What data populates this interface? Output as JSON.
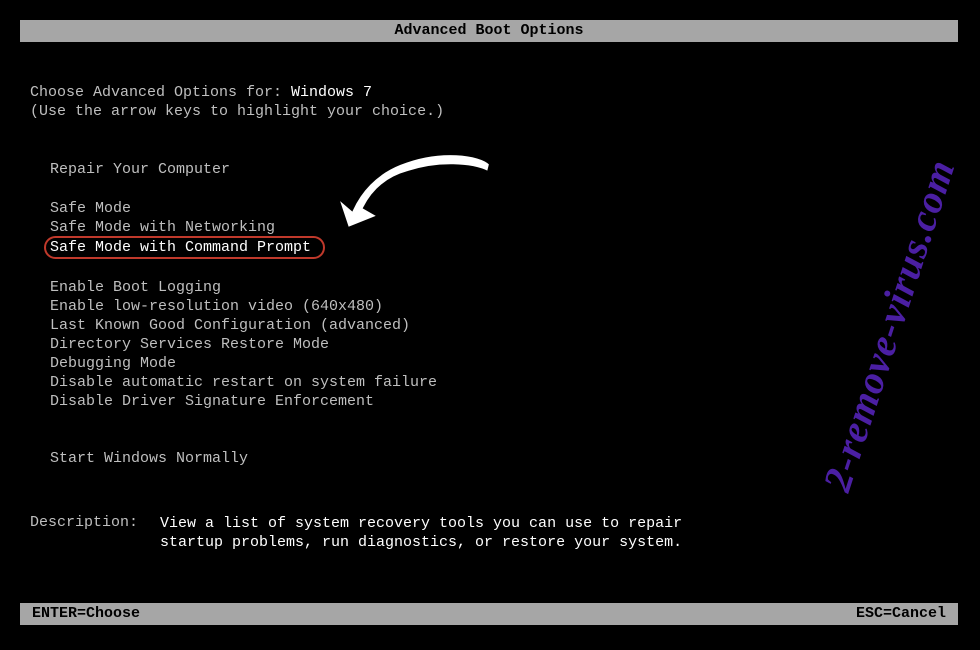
{
  "title": "Advanced Boot Options",
  "prompt_prefix": "Choose Advanced Options for: ",
  "os_name": "Windows 7",
  "hint": "(Use the arrow keys to highlight your choice.)",
  "menu": {
    "group1": [
      "Repair Your Computer"
    ],
    "group2": [
      "Safe Mode",
      "Safe Mode with Networking",
      "Safe Mode with Command Prompt"
    ],
    "group3": [
      "Enable Boot Logging",
      "Enable low-resolution video (640x480)",
      "Last Known Good Configuration (advanced)",
      "Directory Services Restore Mode",
      "Debugging Mode",
      "Disable automatic restart on system failure",
      "Disable Driver Signature Enforcement"
    ],
    "group4": [
      "Start Windows Normally"
    ],
    "highlighted_index": {
      "group": "group2",
      "index": 2
    }
  },
  "description": {
    "label": "Description:",
    "text": "View a list of system recovery tools you can use to repair startup problems, run diagnostics, or restore your system."
  },
  "footer": {
    "enter": "ENTER=Choose",
    "esc": "ESC=Cancel"
  },
  "watermark": "2-remove-virus.com",
  "annotation_icon": "curved-arrow-icon"
}
